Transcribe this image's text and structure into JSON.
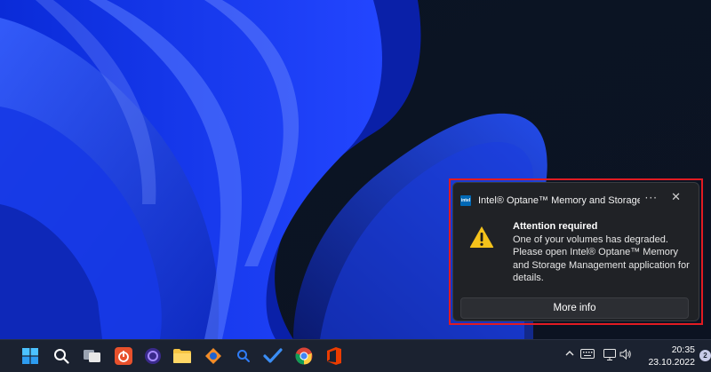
{
  "notification": {
    "app_name": "Intel® Optane™ Memory and Storage Ma...",
    "app_logo_text": "intel",
    "more_label": "···",
    "close_label": "✕",
    "title": "Attention required",
    "message": "One of your volumes has degraded. Please open Intel® Optane™ Memory and Storage Management application for details.",
    "button_label": "More info",
    "highlight_color": "#e11b22"
  },
  "taskbar": {
    "pinned_icons": [
      "windows-start-icon",
      "search-icon",
      "task-view-icon",
      "power-app-icon",
      "browser-app-icon",
      "file-explorer-icon",
      "app-icon",
      "search-app-icon",
      "todo-icon",
      "chrome-icon",
      "office-icon"
    ],
    "tray_icons": [
      "chevron-up-icon",
      "keyboard-icon",
      "network-icon",
      "volume-icon"
    ],
    "clock": {
      "time": "20:35",
      "date": "23.10.2022"
    },
    "notification_count": "2"
  }
}
